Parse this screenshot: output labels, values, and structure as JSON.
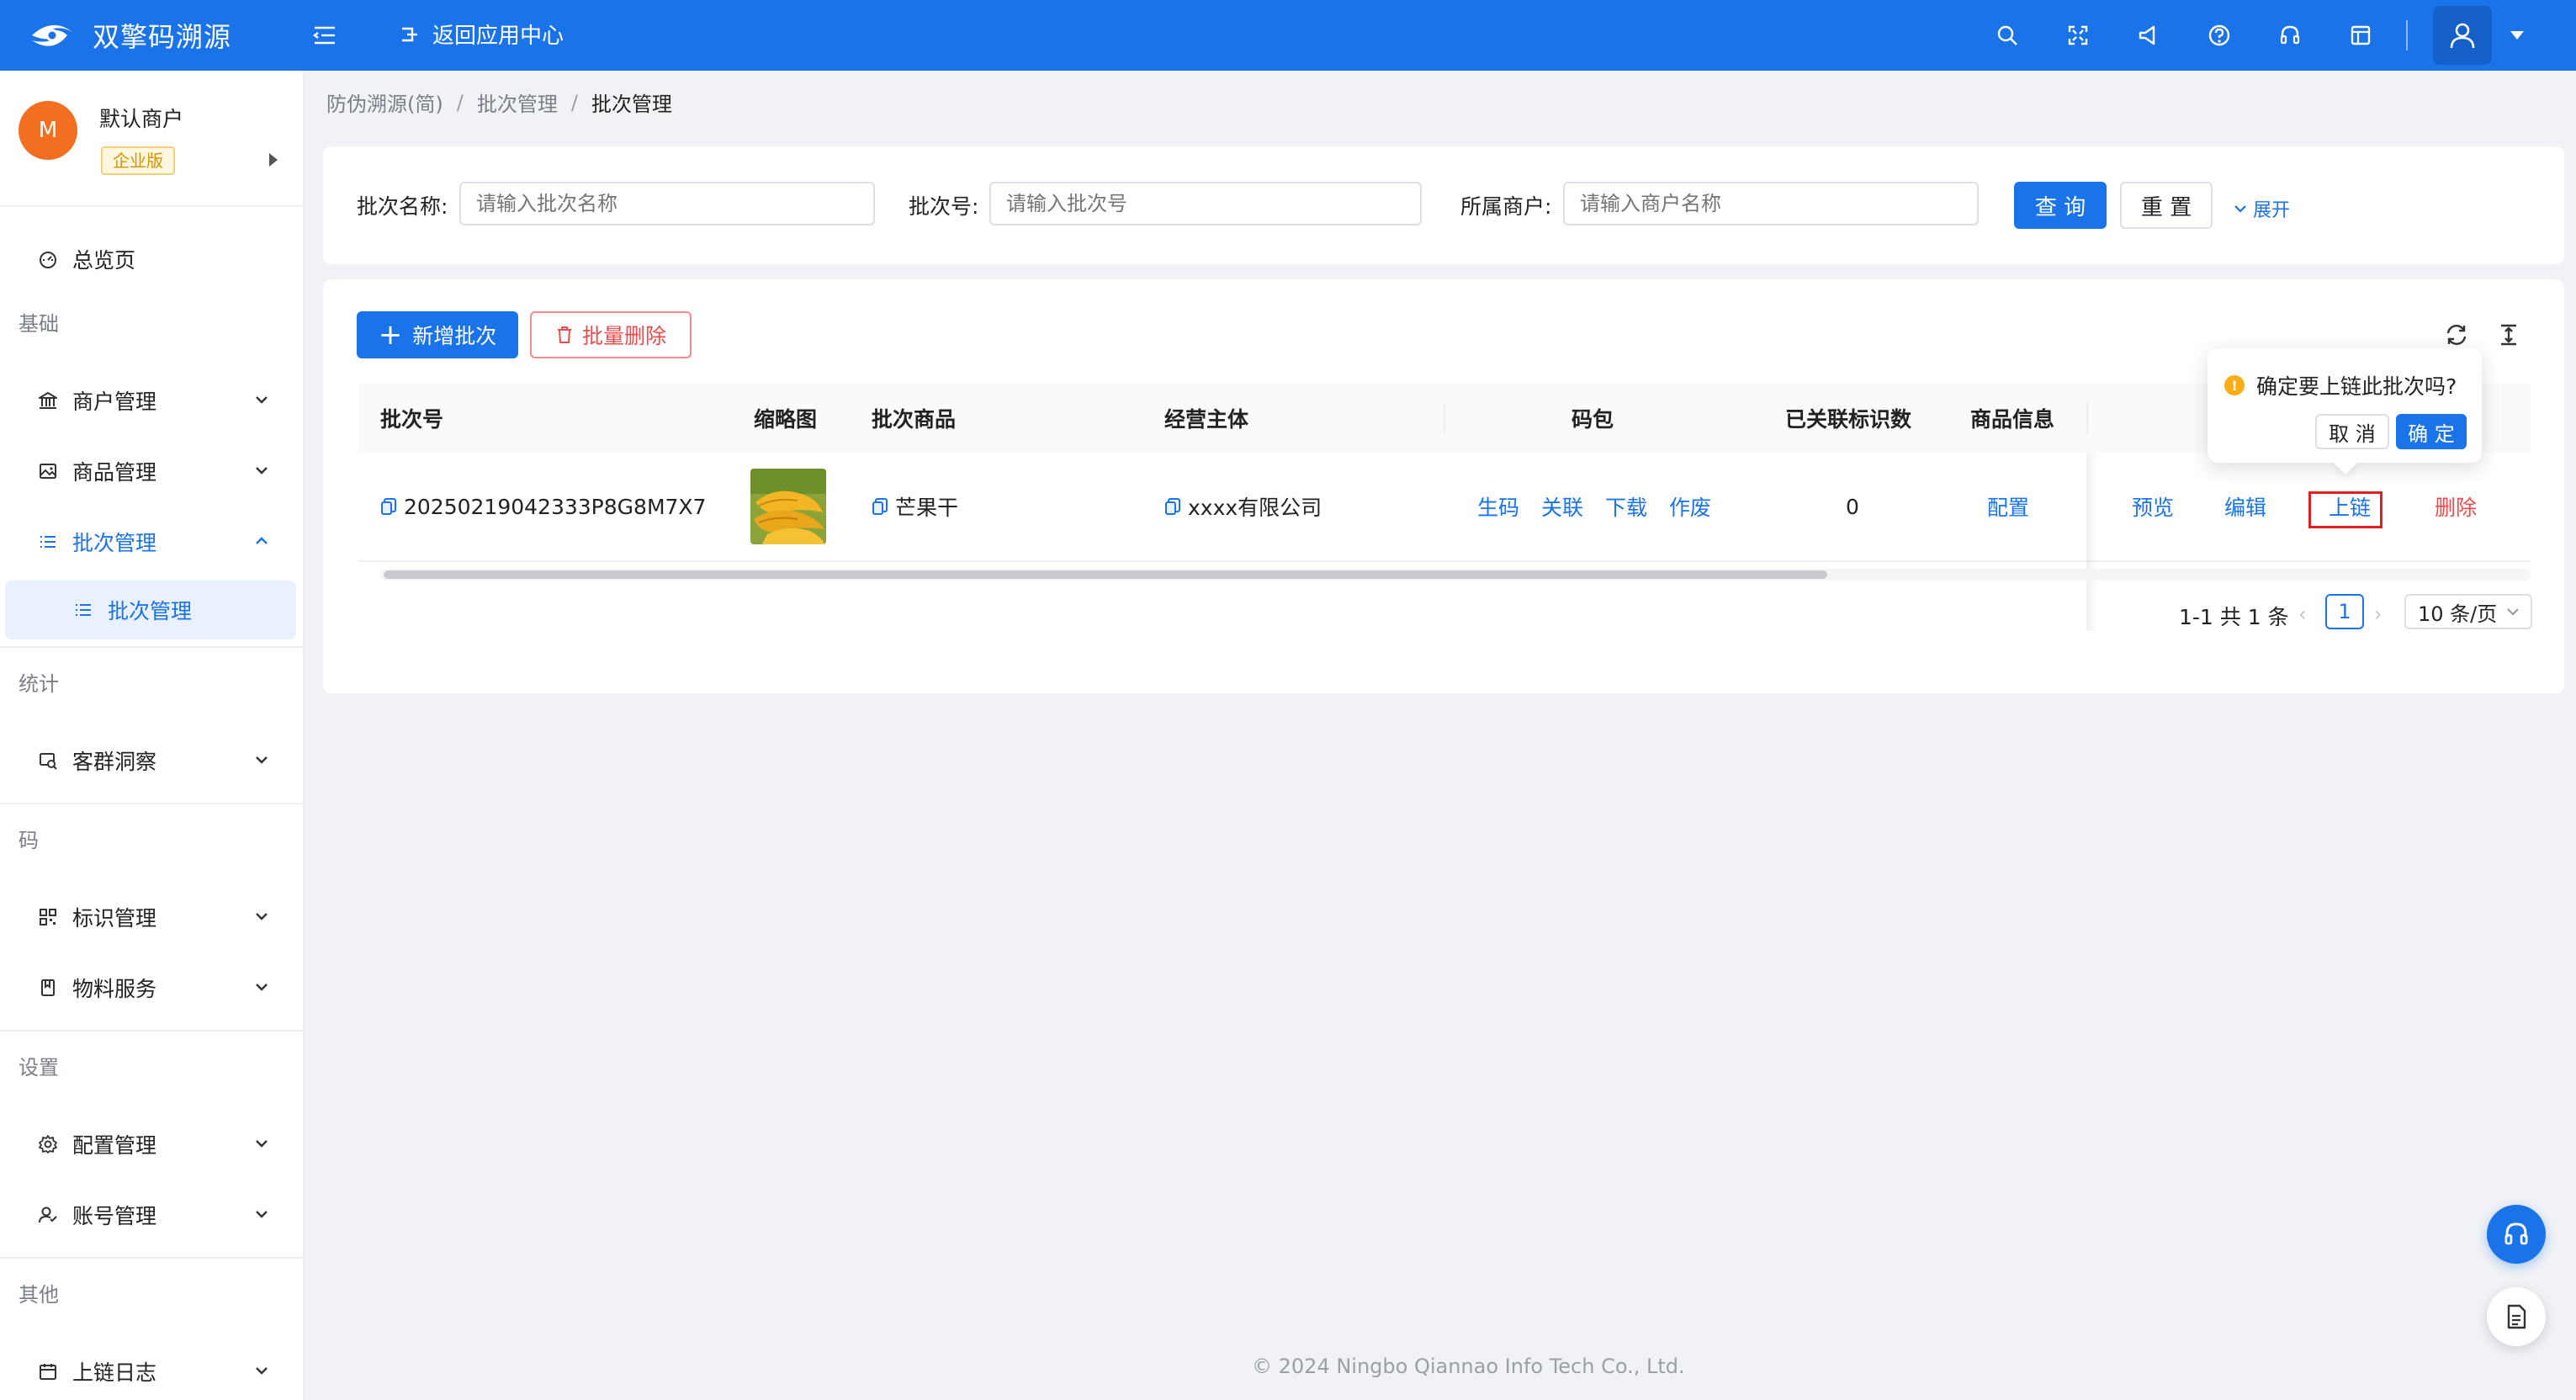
{
  "header": {
    "app_name": "双擎码溯源",
    "back_label": "返回应用中心",
    "brand_color": "#1a73e8"
  },
  "sidebar": {
    "merchant_initial": "M",
    "merchant_name": "默认商户",
    "merchant_tag": "企业版",
    "overview": "总览页",
    "groups": {
      "basic": "基础",
      "stats": "统计",
      "code": "码",
      "settings": "设置",
      "other": "其他"
    },
    "items": {
      "merchant_mgmt": "商户管理",
      "product_mgmt": "商品管理",
      "batch_mgmt": "批次管理",
      "batch_mgmt_sub": "批次管理",
      "customer_insight": "客群洞察",
      "id_mgmt": "标识管理",
      "material_service": "物料服务",
      "config_mgmt": "配置管理",
      "account_mgmt": "账号管理",
      "chain_log": "上链日志"
    }
  },
  "breadcrumb": [
    "防伪溯源(简)",
    "批次管理",
    "批次管理"
  ],
  "search": {
    "batch_name_label": "批次名称:",
    "batch_name_placeholder": "请输入批次名称",
    "batch_no_label": "批次号:",
    "batch_no_placeholder": "请输入批次号",
    "merchant_label": "所属商户:",
    "merchant_placeholder": "请输入商户名称",
    "query_button": "查 询",
    "reset_button": "重 置",
    "expand_link": "展开"
  },
  "toolbar": {
    "add_button": "新增批次",
    "batch_delete_button": "批量删除"
  },
  "table": {
    "columns": [
      "批次号",
      "缩略图",
      "批次商品",
      "经营主体",
      "码包",
      "已关联标识数",
      "商品信息"
    ],
    "rows": [
      {
        "batch_no": "20250219042333P8G8M7X7",
        "thumbnail": "mango-image",
        "product": "芒果干",
        "entity": "xxxx有限公司",
        "code_actions": [
          "生码",
          "关联",
          "下载",
          "作废"
        ],
        "linked_count": "0",
        "product_info": "配置",
        "actions": [
          "预览",
          "编辑",
          "上链",
          "删除"
        ]
      }
    ]
  },
  "pagination": {
    "total_text": "1-1 共 1 条",
    "current_page": "1",
    "page_size": "10 条/页"
  },
  "popconfirm": {
    "message": "确定要上链此批次吗?",
    "cancel": "取 消",
    "ok": "确 定"
  },
  "footer": "© 2024 Ningbo Qiannao Info Tech Co., Ltd."
}
